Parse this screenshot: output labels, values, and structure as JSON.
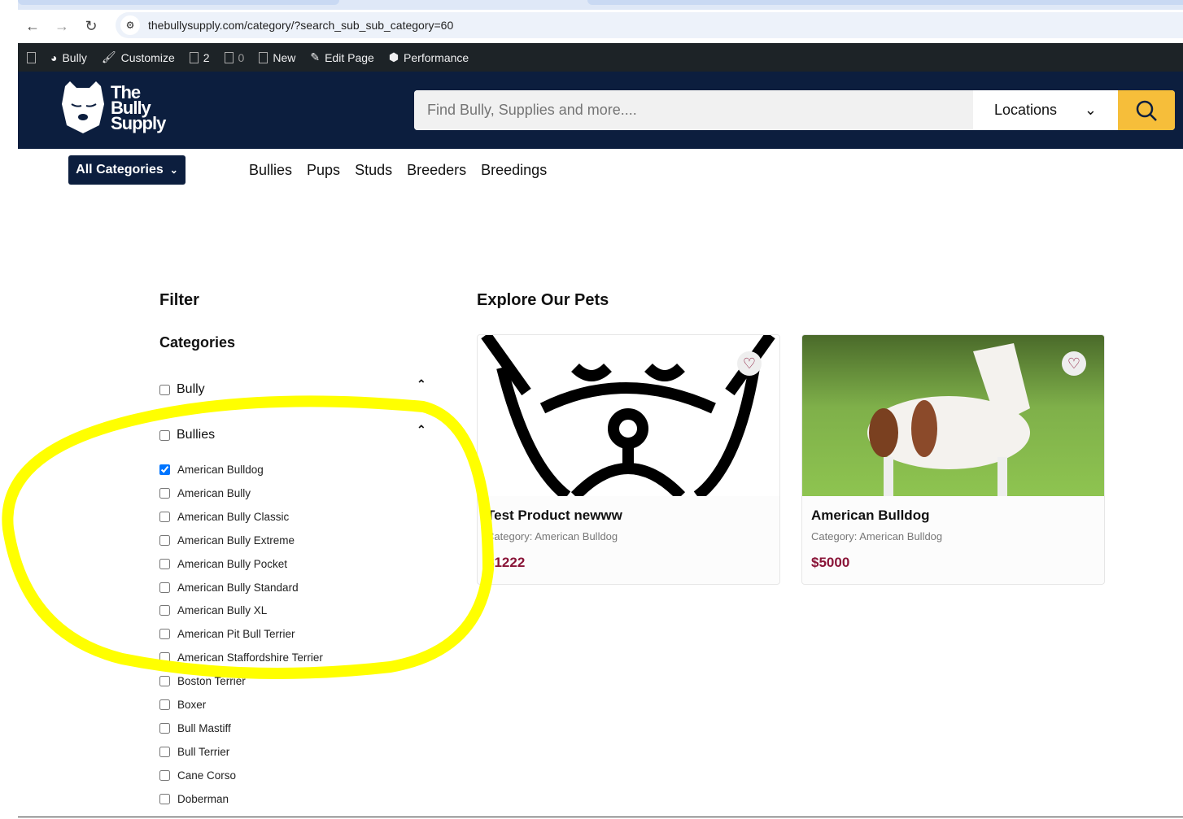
{
  "browser": {
    "url": "thebullysupply.com/category/?search_sub_sub_category=60"
  },
  "admin_bar": {
    "site": "Bully",
    "customize": "Customize",
    "comments": "2",
    "updates": "0",
    "new": "New",
    "edit": "Edit Page",
    "performance": "Performance"
  },
  "header": {
    "logo_text": [
      "The",
      "Bully",
      "Supply"
    ],
    "search_placeholder": "Find Bully, Supplies and more....",
    "locations": "Locations"
  },
  "nav": {
    "all_categories": "All Categories",
    "links": [
      "Bullies",
      "Pups",
      "Studs",
      "Breeders",
      "Breedings"
    ]
  },
  "filter": {
    "title": "Filter",
    "categories_title": "Categories",
    "top": [
      {
        "label": "Bully",
        "checked": false
      },
      {
        "label": "Bullies",
        "checked": false
      }
    ],
    "subs": [
      {
        "label": "American Bulldog",
        "checked": true
      },
      {
        "label": "American Bully",
        "checked": false
      },
      {
        "label": "American Bully Classic",
        "checked": false
      },
      {
        "label": "American Bully Extreme",
        "checked": false
      },
      {
        "label": "American Bully Pocket",
        "checked": false
      },
      {
        "label": "American Bully Standard",
        "checked": false
      },
      {
        "label": "American Bully XL",
        "checked": false
      },
      {
        "label": "American Pit Bull Terrier",
        "checked": false
      },
      {
        "label": "American Staffordshire Terrier",
        "checked": false
      },
      {
        "label": "Boston Terrier",
        "checked": false
      },
      {
        "label": "Boxer",
        "checked": false
      },
      {
        "label": "Bull Mastiff",
        "checked": false
      },
      {
        "label": "Bull Terrier",
        "checked": false
      },
      {
        "label": "Cane Corso",
        "checked": false
      },
      {
        "label": "Doberman",
        "checked": false
      }
    ]
  },
  "main": {
    "title": "Explore Our Pets",
    "products": [
      {
        "name": "Test Product newww",
        "category": "Category: American Bulldog",
        "price": "$1222"
      },
      {
        "name": "American Bulldog",
        "category": "Category: American Bulldog",
        "price": "$5000"
      }
    ]
  },
  "colors": {
    "navy": "#0c1e3e",
    "accent": "#f6be3a",
    "price": "#8a1538",
    "annotation": "#ffff00"
  }
}
